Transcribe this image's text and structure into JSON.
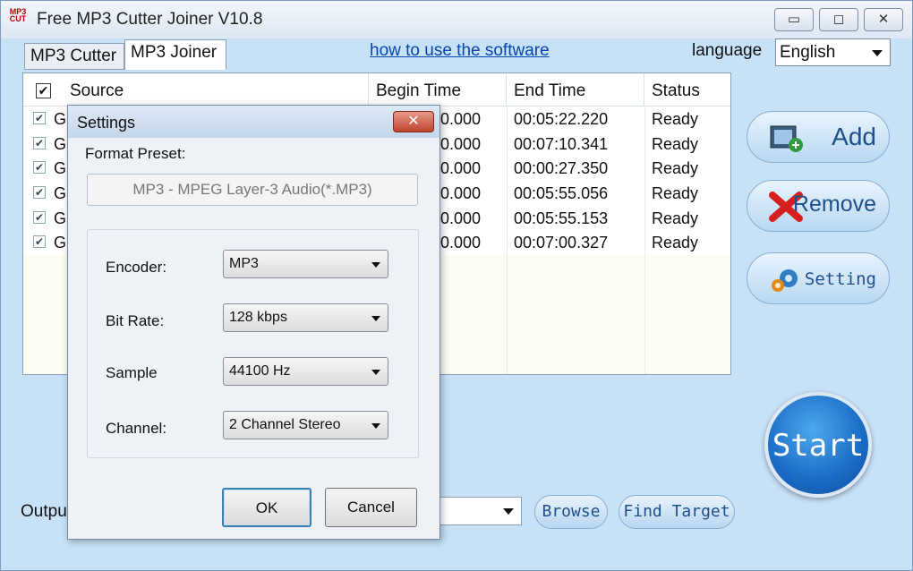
{
  "window": {
    "title": "Free MP3 Cutter Joiner V10.8",
    "icon_text": [
      "MP3",
      "CUT"
    ]
  },
  "titlebar_controls": {
    "minimize": "▭",
    "maximize": "◻",
    "close": "✕"
  },
  "tabs": [
    {
      "label": "MP3 Cutter"
    },
    {
      "label": "MP3 Joiner"
    }
  ],
  "howto_link": "how to use the software",
  "language": {
    "label": "language",
    "value": "English"
  },
  "list": {
    "columns": [
      "Source",
      "Begin Time",
      "End Time",
      "Status"
    ],
    "rows": [
      {
        "source": "G",
        "begin": "0.000",
        "end": "00:05:22.220",
        "status": "Ready"
      },
      {
        "source": "G",
        "begin": "0.000",
        "end": "00:07:10.341",
        "status": "Ready"
      },
      {
        "source": "G",
        "begin": "0.000",
        "end": "00:00:27.350",
        "status": "Ready"
      },
      {
        "source": "G",
        "begin": "0.000",
        "end": "00:05:55.056",
        "status": "Ready"
      },
      {
        "source": "G",
        "begin": "0.000",
        "end": "00:05:55.153",
        "status": "Ready"
      },
      {
        "source": "G",
        "begin": "0.000",
        "end": "00:07:00.327",
        "status": "Ready"
      }
    ]
  },
  "side_buttons": {
    "add": "Add",
    "remove": "Remove",
    "setting": "Setting",
    "start": "Start"
  },
  "output": {
    "label": "Outpu",
    "browse": "Browse",
    "find_target": "Find Target"
  },
  "settings_dialog": {
    "title": "Settings",
    "close": "✕",
    "format_preset_label": "Format Preset:",
    "format_preset_value": "MP3 - MPEG Layer-3 Audio(*.MP3)",
    "encoder": {
      "label": "Encoder:",
      "value": "MP3"
    },
    "bitrate": {
      "label": "Bit Rate:",
      "value": "128 kbps"
    },
    "sample": {
      "label": "Sample",
      "value": "44100 Hz"
    },
    "channel": {
      "label": "Channel:",
      "value": "2 Channel Stereo"
    },
    "ok": "OK",
    "cancel": "Cancel"
  },
  "colors": {
    "window_bg": "#c7e1f7",
    "link": "#0645ad",
    "button_text": "#1f4f8a",
    "start_blue": "#1a6ac5"
  }
}
